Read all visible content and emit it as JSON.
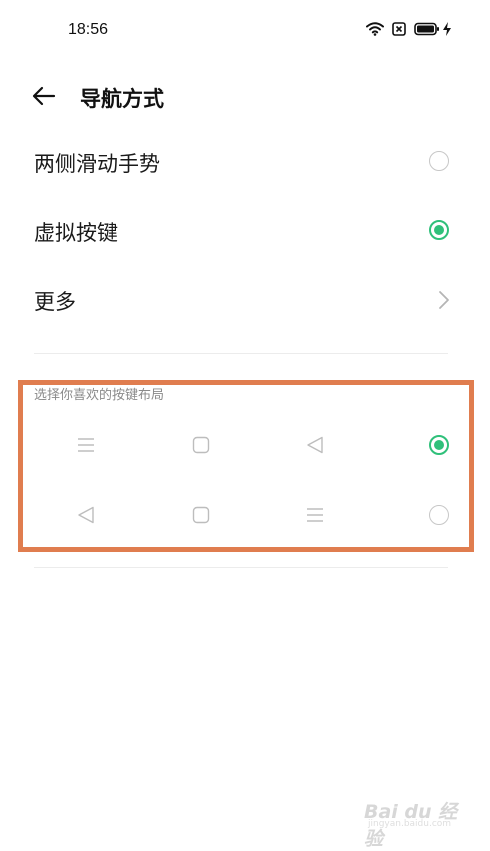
{
  "status_bar": {
    "time": "18:56",
    "icons": [
      "wifi-icon",
      "sim-x-icon",
      "battery-icon",
      "charging-bolt-icon"
    ]
  },
  "header": {
    "back_icon": "arrow-left-icon",
    "title": "导航方式"
  },
  "options": [
    {
      "label": "两侧滑动手势",
      "selected": false
    },
    {
      "label": "虚拟按键",
      "selected": true
    },
    {
      "label": "更多",
      "type": "link",
      "icon": "chevron-right-icon"
    }
  ],
  "layout_section": {
    "subtitle": "选择你喜欢的按键布局",
    "highlight_color": "#e07d4f",
    "rows": [
      {
        "keys": [
          "menu-lines-icon",
          "square-home-icon",
          "triangle-back-icon"
        ],
        "selected": true
      },
      {
        "keys": [
          "triangle-back-icon",
          "square-home-icon",
          "menu-lines-icon"
        ],
        "selected": false
      }
    ]
  },
  "colors": {
    "accent": "#2fc07a",
    "radio_border": "#c7c7c7",
    "divider": "#ececec"
  },
  "watermark": {
    "brand": "Bai du 经验",
    "url": "jingyan.baidu.com"
  }
}
